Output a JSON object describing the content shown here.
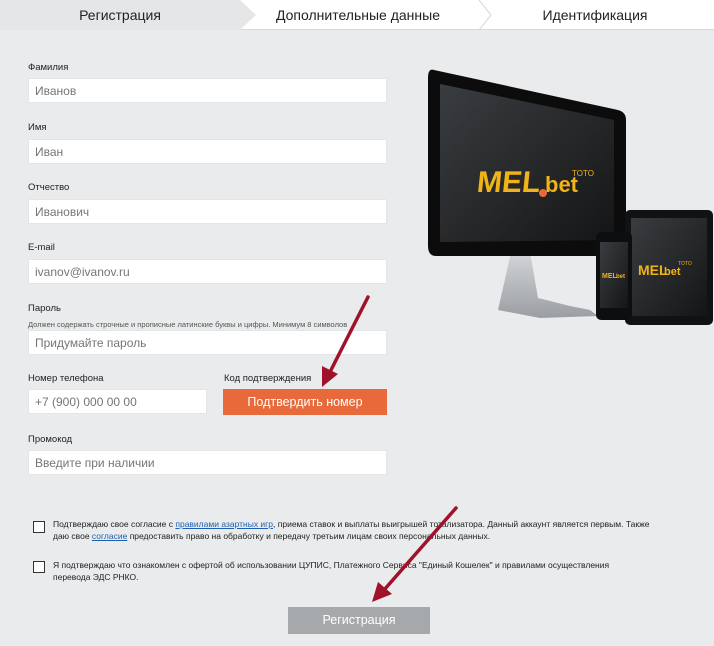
{
  "steps": [
    {
      "label": "Регистрация"
    },
    {
      "label": "Дополнительные данные"
    },
    {
      "label": "Идентификация"
    }
  ],
  "form": {
    "last_name": {
      "label": "Фамилия",
      "placeholder": "Иванов"
    },
    "first_name": {
      "label": "Имя",
      "placeholder": "Иван"
    },
    "patronymic": {
      "label": "Отчество",
      "placeholder": "Иванович"
    },
    "email": {
      "label": "E-mail",
      "placeholder": "ivanov@ivanov.ru"
    },
    "password": {
      "label": "Пароль",
      "hint": "Должен содержать строчные и прописные латинские буквы и цифры. Минимум 8 символов",
      "placeholder": "Придумайте пароль"
    },
    "phone": {
      "label": "Номер телефона",
      "placeholder": "+7 (900) 000 00 00"
    },
    "code": {
      "label": "Код подтверждения",
      "button": "Подтвердить номер"
    },
    "promo": {
      "label": "Промокод",
      "placeholder": "Введите при наличии"
    }
  },
  "agreements": {
    "first": {
      "text_1": "Подтверждаю свое согласие с ",
      "link_1": "правилами азартных игр",
      "text_2": ", приема ставок и выплаты выигрышей тотализатора. Данный аккаунт является первым. Также даю свое ",
      "link_2": "согласие",
      "text_3": " предоставить право на обработку и передачу третьим лицам своих персональных данных."
    },
    "second": {
      "text": "Я подтверждаю что ознакомлен с офертой об использовании ЦУПИС, Платежного Сервиса \"Единый Кошелек\" и правилами осуществления перевода ЭДС РНКО."
    }
  },
  "submit_label": "Регистрация",
  "promo_image": {
    "brand_1": "MEL",
    "brand_2": "bet",
    "brand_3": "TOTO"
  },
  "colors": {
    "accent": "#e86a3b",
    "submit": "#a6a9ab",
    "arrow": "#a0112a",
    "link": "#1f5fb0"
  }
}
